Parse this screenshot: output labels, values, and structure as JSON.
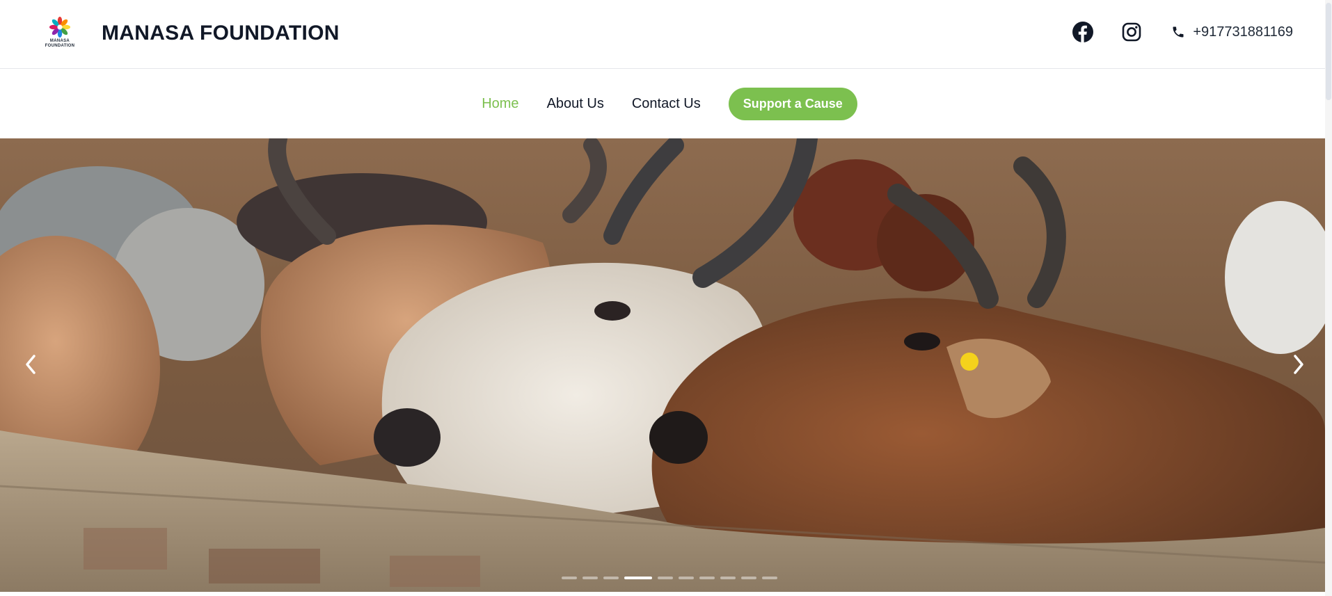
{
  "header": {
    "brand_name": "MANASA FOUNDATION",
    "logo_text_line1": "MANASA",
    "logo_text_line2": "FOUNDATION",
    "phone": "+917731881169",
    "icons": [
      "facebook-icon",
      "instagram-icon",
      "phone-icon"
    ]
  },
  "nav": {
    "items": [
      {
        "label": "Home",
        "active": true
      },
      {
        "label": "About Us",
        "active": false
      },
      {
        "label": "Contact Us",
        "active": false
      }
    ],
    "cta_label": "Support a Cause"
  },
  "hero": {
    "image": "cattle resting heads on stone wall",
    "slide_count": 10,
    "active_slide": 4,
    "icons": [
      "chevron-left-icon",
      "chevron-right-icon"
    ]
  },
  "colors": {
    "accent": "#7cc04f",
    "text": "#111827"
  }
}
